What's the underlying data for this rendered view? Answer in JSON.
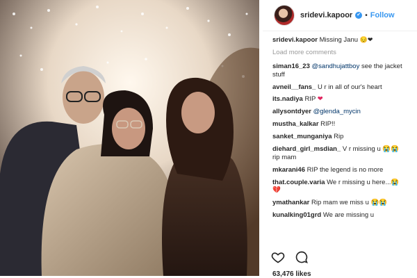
{
  "header": {
    "username": "sridevi.kapoor",
    "verified": "✔",
    "follow_label": "Follow"
  },
  "caption": {
    "user": "sridevi.kapoor",
    "text": "Missing Janu",
    "emojis": "😔❤"
  },
  "load_more": "Load more comments",
  "comments": [
    {
      "user": "siman16_23",
      "mention": "@sandhujattboy",
      "text": " see the jacket",
      "line2": "stuff"
    },
    {
      "user": "avneil__fans_",
      "text": " U r in all of our's heart"
    },
    {
      "user": "its.nadiya",
      "text": " RIP ",
      "emoji": "❤"
    },
    {
      "user": "allysontdyer",
      "mention": "@glenda_mycin",
      "text": ""
    },
    {
      "user": "mustha_kalkar",
      "text": " RIP!!"
    },
    {
      "user": "sanket_munganiya",
      "text": " Rip"
    },
    {
      "user": "diehard_girl_msdian_",
      "text": " V r missing u 😭😭",
      "line2": "rip mam"
    },
    {
      "user": "mkarani46",
      "text": " RIP the legend is no more"
    },
    {
      "user": "that.couple.varia",
      "text": " We r missing u here...😭",
      "line2": "💔"
    },
    {
      "user": "ymathankar",
      "text": " Rip mam we miss u 😭😭"
    },
    {
      "user": "kunalking01grd",
      "text": " We are missing u"
    }
  ],
  "actions": {
    "like_icon": "heart-icon",
    "comment_icon": "comment-icon"
  },
  "likes": "63,476 likes"
}
